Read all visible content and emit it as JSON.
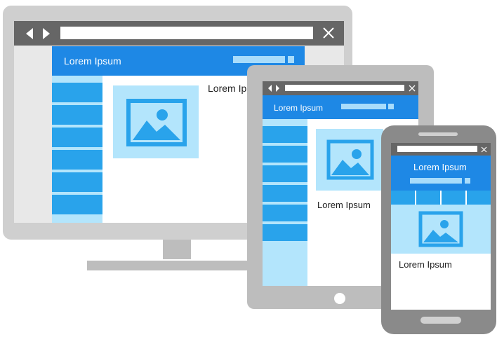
{
  "colors": {
    "accent": "#1e88e5",
    "nav_item": "#29a3eb",
    "light_blue": "#b3e5fc",
    "frame_dark": "#666666",
    "frame_light": "#cfcfcf"
  },
  "icons": {
    "back": "chevron-left-icon",
    "forward": "chevron-right-icon",
    "close": "close-icon",
    "image": "image-placeholder-icon"
  },
  "desktop": {
    "header_title": "Lorem Ipsum",
    "body_text": "Lorem Ip"
  },
  "tablet": {
    "header_title": "Lorem Ipsum",
    "body_text": "Lorem Ipsum"
  },
  "phone": {
    "header_title": "Lorem Ipsum",
    "body_text": "Lorem Ipsum"
  }
}
